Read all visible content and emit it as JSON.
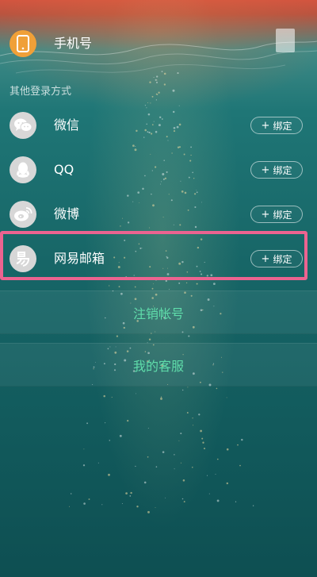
{
  "account": {
    "phone": {
      "label": "手机号",
      "icon": "phone-icon"
    }
  },
  "other_login": {
    "title": "其他登录方式",
    "items": [
      {
        "label": "微信",
        "icon": "wechat-icon",
        "button": "绑定"
      },
      {
        "label": "QQ",
        "icon": "qq-icon",
        "button": "绑定"
      },
      {
        "label": "微博",
        "icon": "weibo-icon",
        "button": "绑定"
      },
      {
        "label": "网易邮箱",
        "icon": "netease-mail-icon",
        "button": "绑定",
        "highlighted": true
      }
    ]
  },
  "actions": {
    "cancel_account": "注销帐号",
    "customer_service": "我的客服"
  },
  "colors": {
    "accent": "#5fdcaa",
    "highlight_border": "#ec6390",
    "phone_icon_bg": "#f0a038"
  },
  "plus_glyph": "+"
}
